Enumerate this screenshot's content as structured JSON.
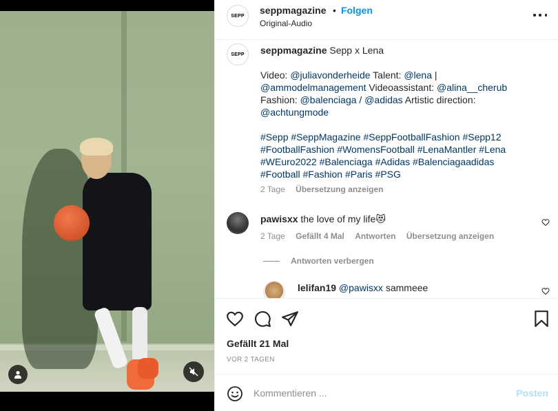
{
  "header": {
    "avatar_text": "SEPP",
    "username": "seppmagazine",
    "separator": "•",
    "follow_label": "Folgen",
    "subtitle": "Original-Audio"
  },
  "caption": {
    "avatar_text": "SEPP",
    "username": "seppmagazine",
    "title": "Sepp x Lena",
    "line_video_label": "Video:",
    "line_video_mention": "@juliavonderheide",
    "talent_label": "Talent:",
    "talent_mention": "@lena",
    "pipe": "|",
    "agency_mention": "@ammodelmanagement",
    "assistant_label": "Videoassistant:",
    "assistant_mention": "@alina__cherub",
    "fashion_label": "Fashion:",
    "fashion_mention1": "@balenciaga",
    "slash": "/",
    "fashion_mention2": "@adidas",
    "direction_label": "Artistic direction:",
    "direction_mention": "@achtungmode",
    "hashtags": [
      "#Sepp",
      "#SeppMagazine",
      "#SeppFootballFashion",
      "#Sepp12",
      "#FootballFashion",
      "#WomensFootball",
      "#LenaMantler",
      "#Lena",
      "#WEuro2022",
      "#Balenciaga",
      "#Adidas",
      "#Balenciagaadidas",
      "#Football",
      "#Fashion",
      "#Paris",
      "#PSG"
    ],
    "age": "2 Tage",
    "translate": "Übersetzung anzeigen"
  },
  "comment1": {
    "username": "pawisxx",
    "text": "the love of my life😻",
    "age": "2 Tage",
    "likes": "Gefällt 4 Mal",
    "reply": "Antworten",
    "translate": "Übersetzung anzeigen"
  },
  "hide_replies": "Antworten verbergen",
  "comment2": {
    "username": "lelifan19",
    "mention": "@pawisxx",
    "text": "sammeee"
  },
  "footer": {
    "likes": "Gefällt 21 Mal",
    "age": "VOR 2 TAGEN",
    "comment_placeholder": "Kommentieren ...",
    "post_label": "Posten"
  },
  "icons": {
    "like": "heart-icon",
    "comment": "comment-icon",
    "share": "paper-plane-icon",
    "save": "bookmark-icon",
    "emoji": "smiley-icon",
    "more": "more-dots-icon",
    "mute": "speaker-muted-icon",
    "user_tag": "user-icon"
  },
  "colors": {
    "accent": "#0095f6",
    "link": "#00376b",
    "secondary": "#8e8e8e",
    "post_disabled": "#b2dffc"
  }
}
